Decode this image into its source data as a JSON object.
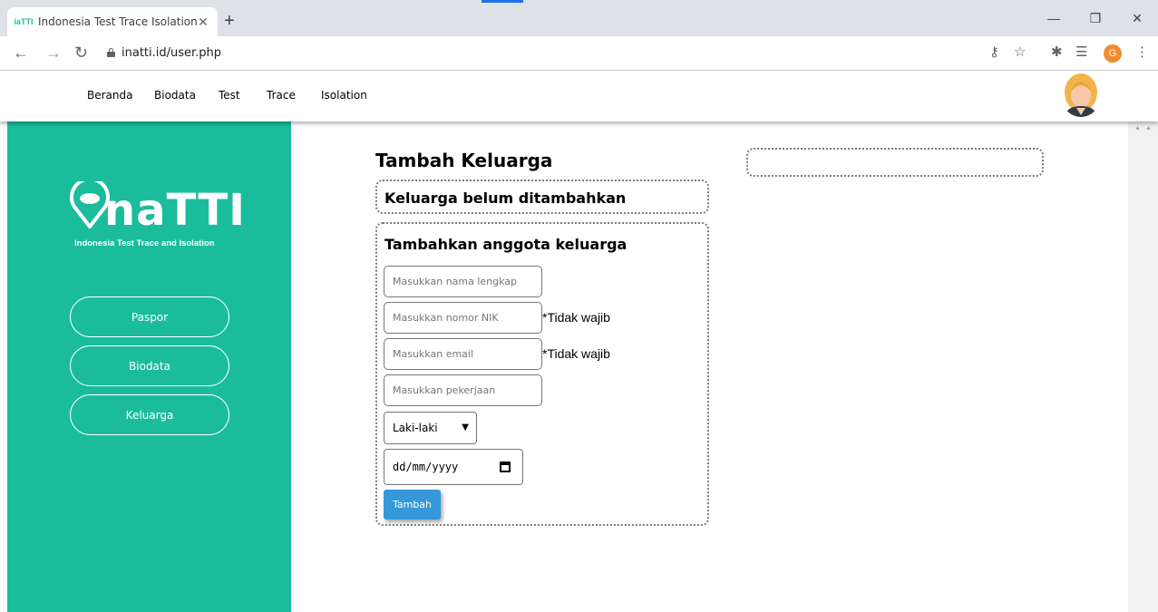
{
  "browser": {
    "tab_title": "Indonesia Test Trace Isolation",
    "favicon_text": "iaTTI",
    "url": "inatti.id/user.php",
    "profile_initial": "G"
  },
  "nav": {
    "links": [
      "Beranda",
      "Biodata",
      "Test",
      "Trace",
      "Isolation"
    ]
  },
  "sidebar": {
    "logo_text": "naTTI",
    "logo_subtitle": "Indonesia Test Trace and Isolation",
    "buttons": [
      "Paspor",
      "Biodata",
      "Keluarga"
    ],
    "background_color": "#1abc9c"
  },
  "main": {
    "title": "Tambah Keluarga",
    "status_text": "Keluarga belum ditambahkan",
    "form": {
      "title": "Tambahkan anggota keluarga",
      "name_placeholder": "Masukkan nama lengkap",
      "nik_placeholder": "Masukkan nomor NIK",
      "nik_note": "*Tidak wajib",
      "email_placeholder": "Masukkan email",
      "email_note": "*Tidak wajib",
      "job_placeholder": "Masukkan pekerjaan",
      "gender_selected": "Laki-laki",
      "date_placeholder": "dd/mm/yyyy",
      "submit_label": "Tambah",
      "submit_color": "#3498db"
    }
  }
}
